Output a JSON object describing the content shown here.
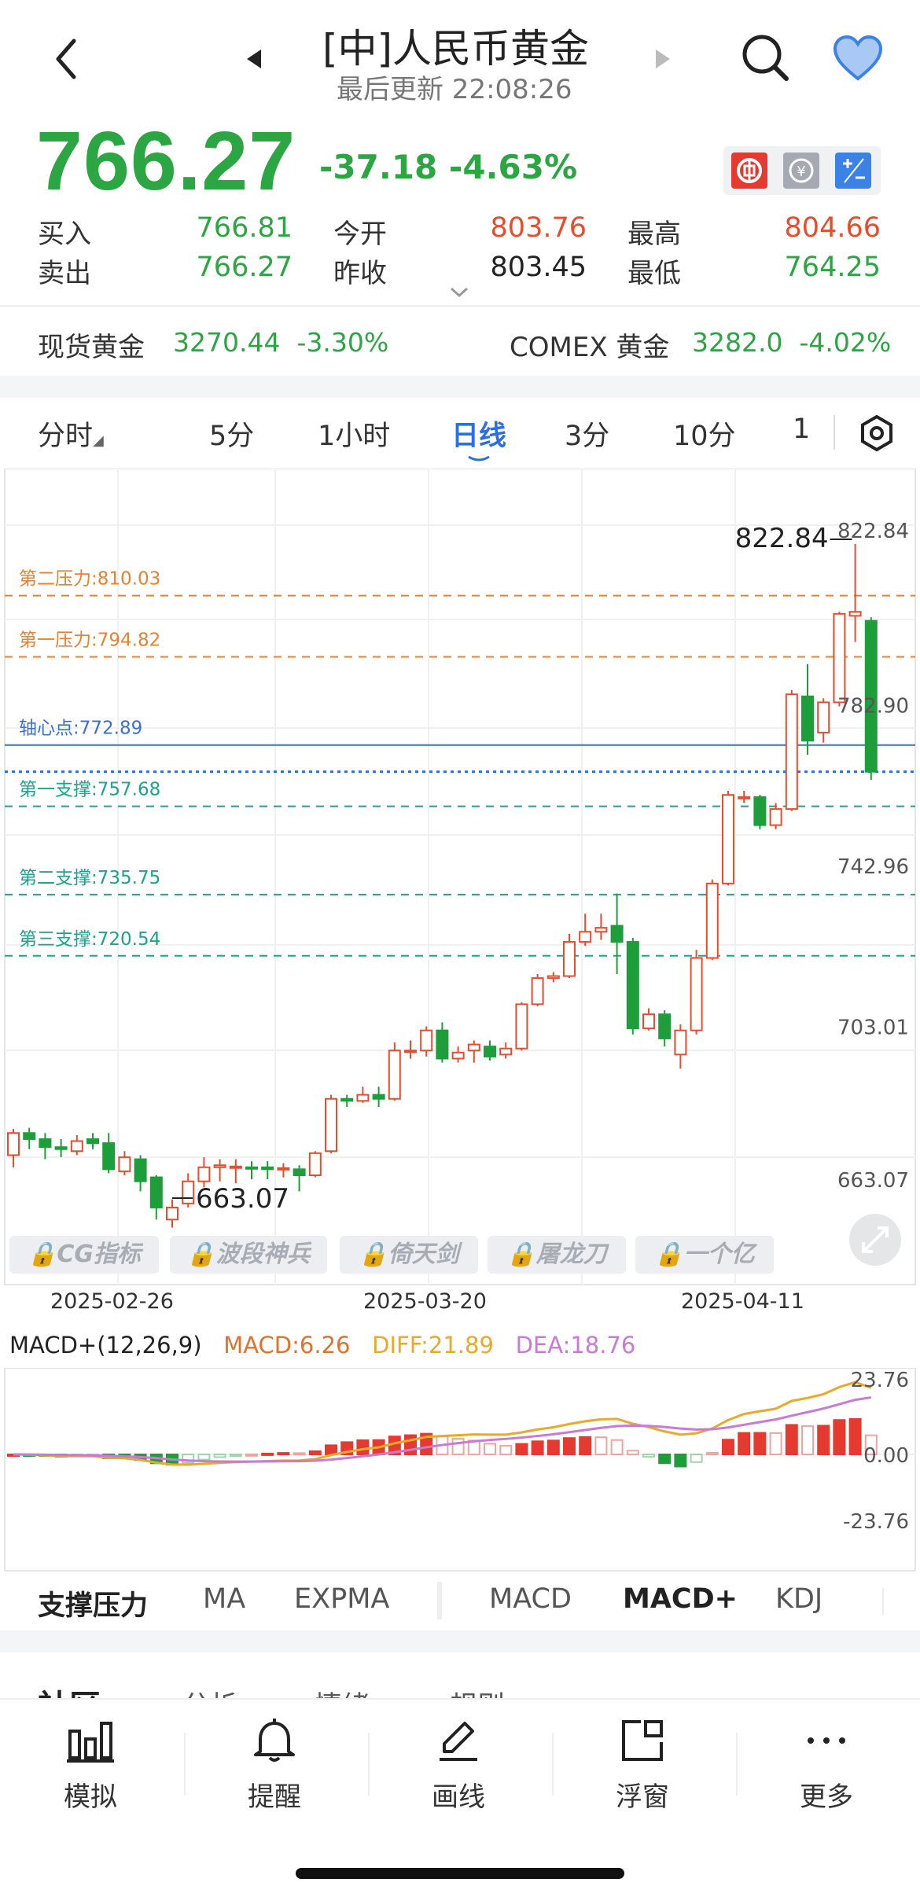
{
  "header": {
    "title": "[中]人民币黄金",
    "subtitle": "最后更新 22:08:26"
  },
  "quote": {
    "price": "766.27",
    "change": "-37.18",
    "change_pct": "-4.63%",
    "bid_label": "买入",
    "bid": "766.81",
    "ask_label": "卖出",
    "ask": "766.27",
    "open_label": "今开",
    "open": "803.76",
    "prev_label": "昨收",
    "prev": "803.45",
    "high_label": "最高",
    "high": "804.66",
    "low_label": "最低",
    "low": "764.25"
  },
  "related": {
    "spot_label": "现货黄金",
    "spot_value": "3270.44",
    "spot_pct": "-3.30%",
    "comex_label": "COMEX 黄金",
    "comex_value": "3282.0",
    "comex_pct": "-4.02%"
  },
  "period_tabs": [
    "分时",
    "5分",
    "1小时",
    "日线",
    "3分",
    "10分",
    "1"
  ],
  "active_period": "日线",
  "chart": {
    "max_label": "822.84",
    "max_axis": "822.84",
    "min_label": "663.07",
    "y_ticks": [
      "822.84",
      "782.90",
      "742.96",
      "703.01",
      "663.07"
    ],
    "levels": [
      {
        "name": "第二压力:810.03",
        "value": 810.03,
        "color": "#e8822f"
      },
      {
        "name": "第一压力:794.82",
        "value": 794.82,
        "color": "#e8822f"
      },
      {
        "name": "轴心点:772.89",
        "value": 772.89,
        "color": "#3d6fd0"
      },
      {
        "name": "第一支撑:757.68",
        "value": 757.68,
        "color": "#1aa58d"
      },
      {
        "name": "第二支撑:735.75",
        "value": 735.75,
        "color": "#1aa58d"
      },
      {
        "name": "第三支撑:720.54",
        "value": 720.54,
        "color": "#1aa58d"
      }
    ],
    "current_price": 766.27,
    "x_dates": [
      "2025-02-26",
      "2025-03-20",
      "2025-04-11"
    ],
    "locked_tools": [
      "CG指标",
      "波段神兵",
      "倚天剑",
      "屠龙刀",
      "一个亿"
    ]
  },
  "macd": {
    "title": "MACD+(12,26,9)",
    "macd": "MACD:6.26",
    "diff": "DIFF:21.89",
    "dea": "DEA:18.76",
    "y_ticks": [
      "23.76",
      "0.00",
      "-23.76"
    ]
  },
  "indicator_tabs": [
    "支撑压力",
    "MA",
    "EXPMA",
    "MACD",
    "MACD+",
    "KDJ"
  ],
  "community_tabs": [
    "社区",
    "分析",
    "情绪",
    "规则"
  ],
  "bottom_nav": [
    "模拟",
    "提醒",
    "画线",
    "浮窗",
    "更多"
  ],
  "colors": {
    "up": "#e74c2c",
    "down": "#2ca543",
    "accent": "#2b6fe0"
  },
  "chart_data": {
    "type": "candlestick",
    "ylim": [
      663.07,
      822.84
    ],
    "candles": [
      [
        671.0,
        676.5,
        668.0,
        677.5
      ],
      [
        676.5,
        675.0,
        672.5,
        677.8
      ],
      [
        675.0,
        673.0,
        670.0,
        676.5
      ],
      [
        673.0,
        672.5,
        670.5,
        675.0
      ],
      [
        672.0,
        674.5,
        671.0,
        676.0
      ],
      [
        675.0,
        674.0,
        672.5,
        676.5
      ],
      [
        674.0,
        667.5,
        666.5,
        676.5
      ],
      [
        667.0,
        670.5,
        666.0,
        672.0
      ],
      [
        670.0,
        664.5,
        662.0,
        671.0
      ],
      [
        665.5,
        658.0,
        655.0,
        666.0
      ],
      [
        655.0,
        658.0,
        653.0,
        660.0
      ],
      [
        659.0,
        664.5,
        658.0,
        666.5
      ],
      [
        664.5,
        668.0,
        663.0,
        670.5
      ],
      [
        668.0,
        668.5,
        664.5,
        670.0
      ],
      [
        668.0,
        668.2,
        664.0,
        670.0
      ],
      [
        668.0,
        667.8,
        665.0,
        669.5
      ],
      [
        668.0,
        667.5,
        665.0,
        669.5
      ],
      [
        667.5,
        667.8,
        665.5,
        669.0
      ],
      [
        667.5,
        666.0,
        662.0,
        668.5
      ],
      [
        666.0,
        671.5,
        665.5,
        672.0
      ],
      [
        672.0,
        685.0,
        671.5,
        686.0
      ],
      [
        685.0,
        684.5,
        683.0,
        686.0
      ],
      [
        684.5,
        686.0,
        684.0,
        688.0
      ],
      [
        686.0,
        685.0,
        683.0,
        688.0
      ],
      [
        685.0,
        697.0,
        684.5,
        699.0
      ],
      [
        697.0,
        697.0,
        695.0,
        699.5
      ],
      [
        697.0,
        702.0,
        695.5,
        703.0
      ],
      [
        702.0,
        695.0,
        694.0,
        704.0
      ],
      [
        695.0,
        696.5,
        694.0,
        698.0
      ],
      [
        697.0,
        698.5,
        694.0,
        699.5
      ],
      [
        698.0,
        695.5,
        694.5,
        699.5
      ],
      [
        696.0,
        697.5,
        695.0,
        699.0
      ],
      [
        697.5,
        708.5,
        697.0,
        709.0
      ],
      [
        708.5,
        715.0,
        708.0,
        716.0
      ],
      [
        715.0,
        715.5,
        714.0,
        716.5
      ],
      [
        715.5,
        724.0,
        715.0,
        726.0
      ],
      [
        724.0,
        726.5,
        723.0,
        731.0
      ],
      [
        726.5,
        727.5,
        724.5,
        731.0
      ],
      [
        728.0,
        724.0,
        716.0,
        736.0
      ],
      [
        724.0,
        702.5,
        701.0,
        725.0
      ],
      [
        702.5,
        706.0,
        702.0,
        707.5
      ],
      [
        706.0,
        700.0,
        698.0,
        707.0
      ],
      [
        696.0,
        702.0,
        692.5,
        703.5
      ],
      [
        702.0,
        720.0,
        701.0,
        722.0
      ],
      [
        720.0,
        738.5,
        719.5,
        739.5
      ],
      [
        738.5,
        760.5,
        738.0,
        761.5
      ],
      [
        760.0,
        760.0,
        758.5,
        761.5
      ],
      [
        760.0,
        753.0,
        752.0,
        760.5
      ],
      [
        753.0,
        757.0,
        752.0,
        758.5
      ],
      [
        757.0,
        785.5,
        756.5,
        786.5
      ],
      [
        785.0,
        774.0,
        770.5,
        793.0
      ],
      [
        776.0,
        783.5,
        773.5,
        784.5
      ],
      [
        783.5,
        805.5,
        782.5,
        806.0
      ],
      [
        805.0,
        806.0,
        798.5,
        822.84
      ],
      [
        803.76,
        766.27,
        764.25,
        804.66
      ]
    ]
  }
}
